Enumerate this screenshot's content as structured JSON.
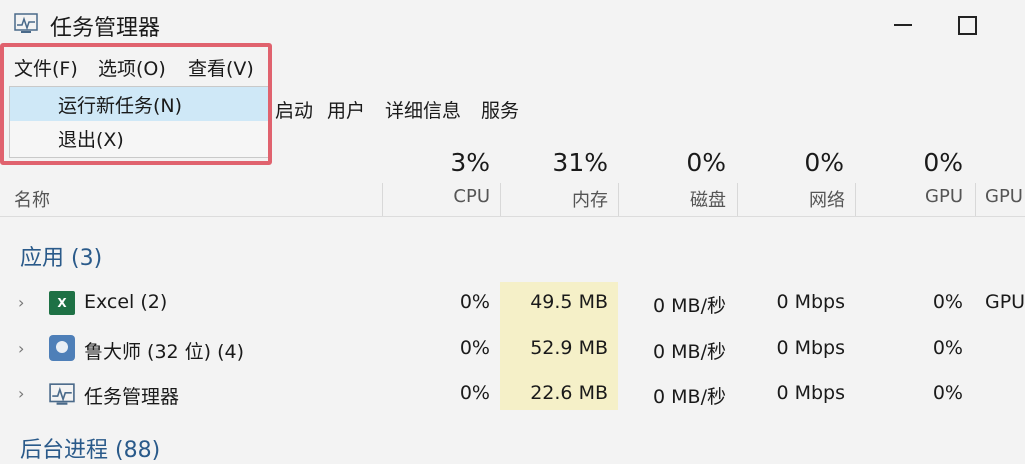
{
  "window": {
    "title": "任务管理器"
  },
  "menubar": {
    "file": "文件(F)",
    "options": "选项(O)",
    "view": "查看(V)"
  },
  "dropdown": {
    "run_new_task": "运行新任务(N)",
    "exit": "退出(X)"
  },
  "tabs": {
    "startup_partial": "启动",
    "users": "用户",
    "details": "详细信息",
    "services": "服务"
  },
  "columns": {
    "name": "名称",
    "cpu": {
      "pct": "3%",
      "label": "CPU"
    },
    "memory": {
      "pct": "31%",
      "label": "内存"
    },
    "disk": {
      "pct": "0%",
      "label": "磁盘"
    },
    "network": {
      "pct": "0%",
      "label": "网络"
    },
    "gpu": {
      "pct": "0%",
      "label": "GPU"
    },
    "gpu_engine_partial": "GPU"
  },
  "group": {
    "apps": "应用 (3)",
    "background_partial": "后台进程 (88)"
  },
  "rows": [
    {
      "name": "Excel (2)",
      "cpu": "0%",
      "memory": "49.5 MB",
      "disk": "0 MB/秒",
      "network": "0 Mbps",
      "gpu": "0%",
      "gpu_engine": "GPU"
    },
    {
      "name": "鲁大师 (32 位) (4)",
      "cpu": "0%",
      "memory": "52.9 MB",
      "disk": "0 MB/秒",
      "network": "0 Mbps",
      "gpu": "0%",
      "gpu_engine": ""
    },
    {
      "name": "任务管理器",
      "cpu": "0%",
      "memory": "22.6 MB",
      "disk": "0 MB/秒",
      "network": "0 Mbps",
      "gpu": "0%",
      "gpu_engine": ""
    }
  ],
  "icons": {
    "app": "task-manager-icon",
    "excel": "excel-icon",
    "ludashi": "ludashi-icon",
    "taskmgr": "task-manager-icon"
  },
  "colors": {
    "highlight_frame": "#e0626e",
    "menu_hover": "#cfe8f7",
    "memory_heat": "#f5f0c8"
  }
}
